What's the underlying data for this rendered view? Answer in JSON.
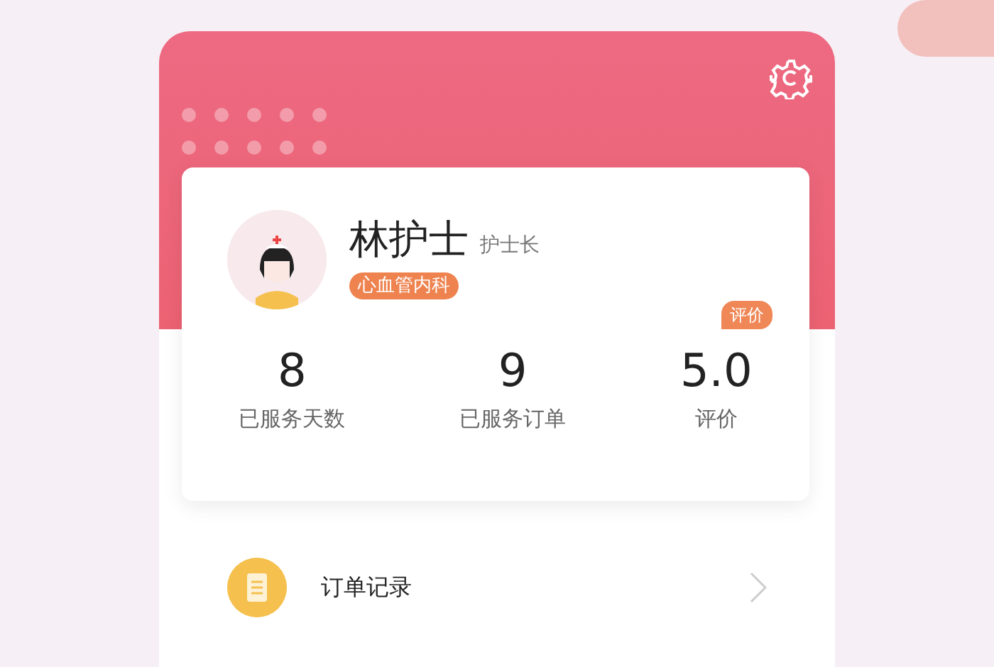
{
  "profile": {
    "name": "林护士",
    "title": "护士长",
    "department": "心血管内科"
  },
  "stats": [
    {
      "value": "8",
      "label": "已服务天数"
    },
    {
      "value": "9",
      "label": "已服务订单"
    },
    {
      "value": "5.0",
      "label": "评价",
      "badge": "评价"
    }
  ],
  "menu": [
    {
      "label": "订单记录"
    }
  ]
}
